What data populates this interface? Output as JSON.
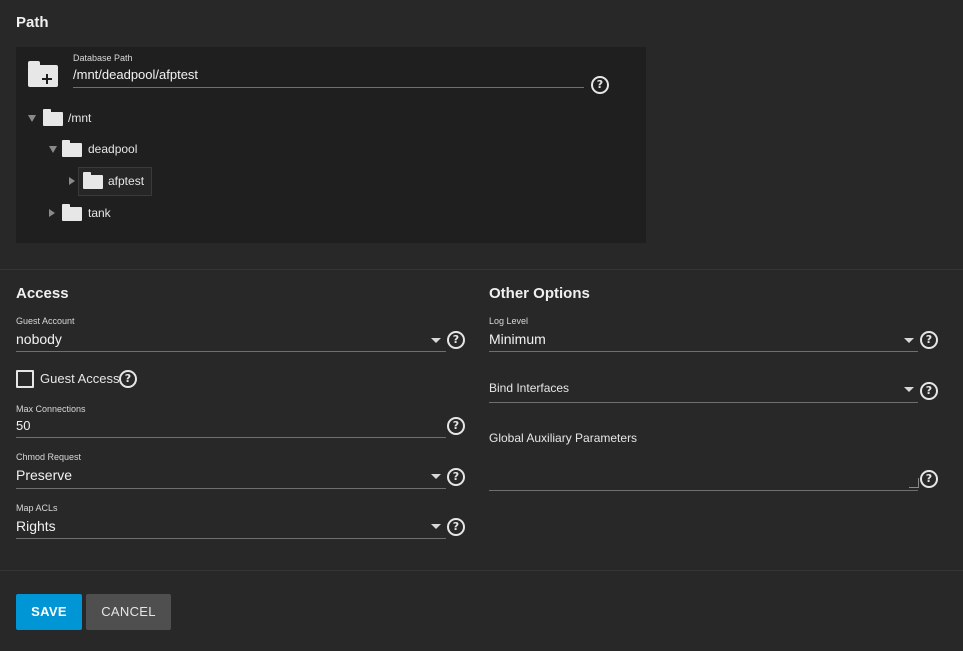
{
  "path": {
    "title": "Path",
    "database_path_label": "Database Path",
    "database_path_value": "/mnt/deadpool/afptest",
    "tree": [
      {
        "label": "/mnt",
        "expanded": true
      },
      {
        "label": "deadpool",
        "expanded": true
      },
      {
        "label": "afptest",
        "expanded": false,
        "selected": true
      },
      {
        "label": "tank",
        "expanded": false
      }
    ]
  },
  "access": {
    "title": "Access",
    "guest_account_label": "Guest Account",
    "guest_account_value": "nobody",
    "guest_access_label": "Guest Access",
    "guest_access_checked": false,
    "max_connections_label": "Max Connections",
    "max_connections_value": "50",
    "chmod_request_label": "Chmod Request",
    "chmod_request_value": "Preserve",
    "map_acls_label": "Map ACLs",
    "map_acls_value": "Rights"
  },
  "other": {
    "title": "Other Options",
    "log_level_label": "Log Level",
    "log_level_value": "Minimum",
    "bind_interfaces_label": "Bind Interfaces",
    "bind_interfaces_value": "",
    "aux_params_label": "Global Auxiliary Parameters",
    "aux_params_value": ""
  },
  "actions": {
    "save_label": "SAVE",
    "cancel_label": "CANCEL"
  },
  "colors": {
    "background": "#282828",
    "tree_panel": "#1f1f1f",
    "primary": "#0095d5",
    "secondary_button": "#4f4f4f"
  },
  "icons": {
    "help": "?"
  }
}
